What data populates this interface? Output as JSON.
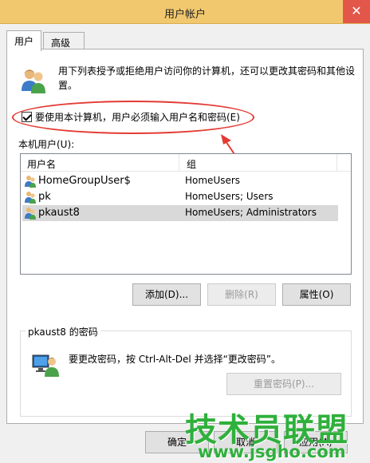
{
  "window": {
    "title": "用户帐户",
    "close_glyph": "✕"
  },
  "tabs": [
    {
      "label": "用户",
      "active": true
    },
    {
      "label": "高级",
      "active": false
    }
  ],
  "description": "用下列表授予或拒绝用户访问你的计算机，还可以更改其密码和其他设置。",
  "require_login": {
    "label": "要使用本计算机，用户必须输入用户名和密码(E)",
    "checked": true
  },
  "users_section": {
    "label": "本机用户(U):",
    "columns": [
      "用户名",
      "组"
    ],
    "rows": [
      {
        "name": "HomeGroupUser$",
        "group": "HomeUsers",
        "selected": false
      },
      {
        "name": "pk",
        "group": "HomeUsers; Users",
        "selected": false
      },
      {
        "name": "pkaust8",
        "group": "HomeUsers; Administrators",
        "selected": true
      }
    ]
  },
  "buttons": {
    "add": "添加(D)...",
    "remove": "删除(R)",
    "properties": "属性(O)",
    "ok": "确定",
    "cancel": "取消",
    "apply": "应用(A)"
  },
  "password_section": {
    "title": "pkaust8 的密码",
    "text": "要更改密码，按 Ctrl-Alt-Del 并选择“更改密码”。",
    "reset_button": "重置密码(P)..."
  },
  "watermark": {
    "main": "技术员联盟",
    "url": "www.jsgho.com"
  },
  "colors": {
    "titlebar": "#f2c86f",
    "close": "#e2574a",
    "annotation": "#e33b33",
    "watermark": "#2fb03c"
  }
}
